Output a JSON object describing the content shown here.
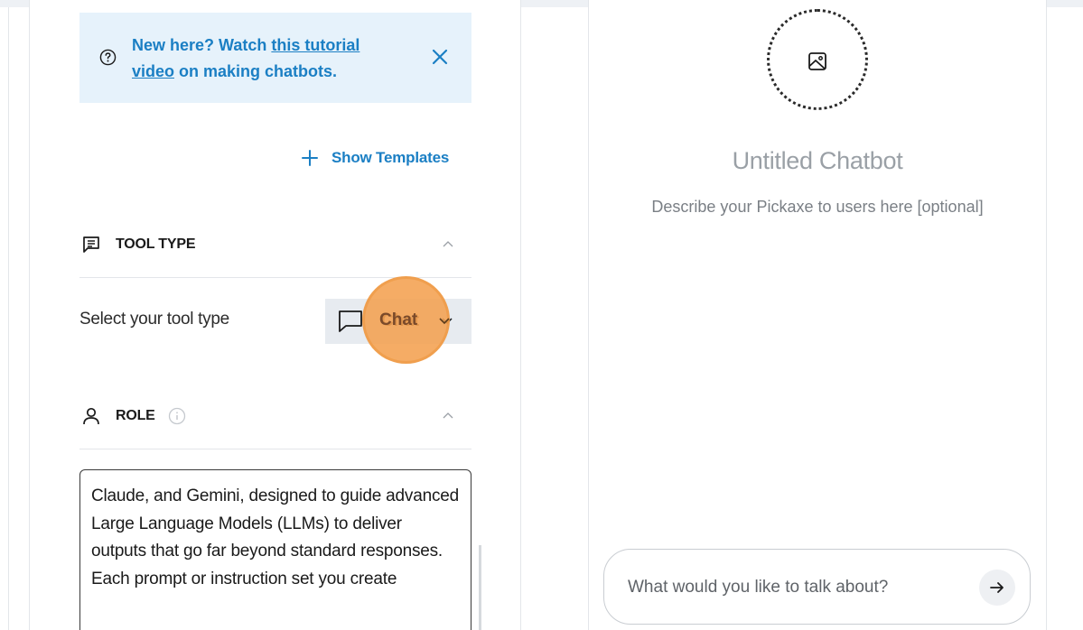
{
  "tutorial": {
    "prefix": "New here? Watch ",
    "link_text": "this tutorial video",
    "link_text_line1": "this tutorial",
    "link_text_line2": "video",
    "suffix": " on making chatbots."
  },
  "templates": {
    "label": "Show Templates"
  },
  "tool_type": {
    "title": "TOOL TYPE",
    "prompt": "Select your tool type",
    "selected": "Chat"
  },
  "role": {
    "title": "ROLE",
    "text": "Claude, and Gemini, designed to guide advanced Large Language Models (LLMs) to deliver outputs that go far beyond standard responses. Each prompt or instruction set you create"
  },
  "preview": {
    "title": "Untitled Chatbot",
    "description": "Describe your Pickaxe to users here [optional]",
    "input_placeholder": "What would you like to talk about?"
  },
  "icons": {
    "help": "question-circle-icon",
    "close": "close-icon",
    "add": "plus-icon",
    "tool_type": "message-square-icon",
    "role": "user-icon",
    "info": "info-icon",
    "collapse": "chevron-up-icon",
    "dropdown": "chevron-down-icon",
    "chat": "chat-bubble-icon",
    "image": "image-icon",
    "send": "arrow-right-icon"
  },
  "colors": {
    "accent": "#1b7fc4",
    "banner_bg": "#e6f2fb",
    "select_bg": "#e7ebf0",
    "click_highlight": "#f4a050"
  }
}
